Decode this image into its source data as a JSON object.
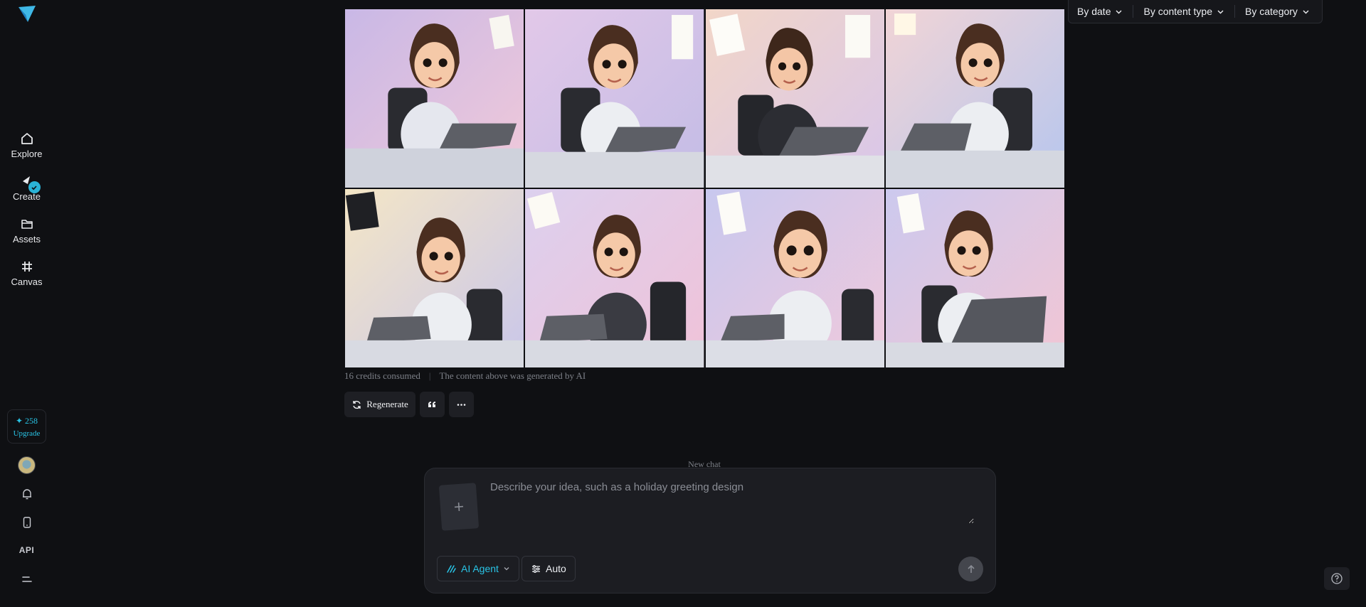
{
  "sidebar": {
    "nav": [
      {
        "label": "Explore",
        "icon": "home-icon"
      },
      {
        "label": "Create",
        "icon": "create-icon"
      },
      {
        "label": "Assets",
        "icon": "folder-icon"
      },
      {
        "label": "Canvas",
        "icon": "canvas-icon"
      }
    ],
    "credits": {
      "count": "✦ 258",
      "upgrade": "Upgrade"
    },
    "api_label": "API"
  },
  "filters": [
    "By date",
    "By content type",
    "By category"
  ],
  "result": {
    "credits_text": "16 credits consumed",
    "separator": "|",
    "disclaimer": "The content above was generated by AI",
    "regenerate_label": "Regenerate"
  },
  "new_chat_label": "New chat",
  "composer": {
    "placeholder": "Describe your idea, such as a holiday greeting design",
    "agent_label": "AI Agent",
    "auto_label": "Auto"
  },
  "colors": {
    "accent": "#29c4e6",
    "background": "#0f1013",
    "panel": "#1c1d22"
  }
}
